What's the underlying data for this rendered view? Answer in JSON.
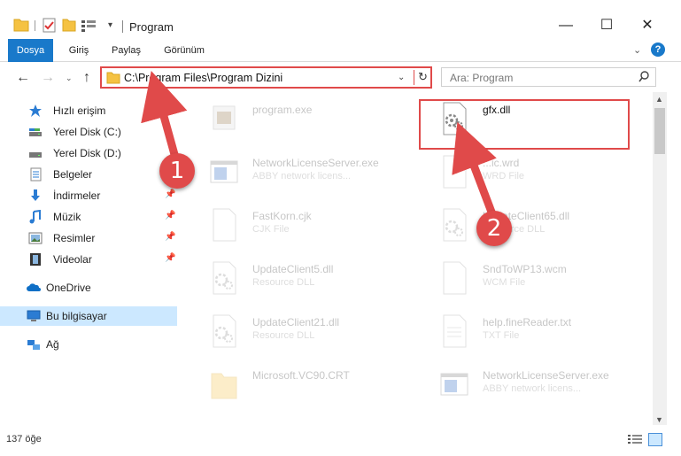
{
  "window": {
    "title": "Program",
    "minimize": "—",
    "maximize": "☐",
    "close": "✕"
  },
  "ribbon": {
    "tabs": [
      "Dosya",
      "Giriş",
      "Paylaş",
      "Görünüm"
    ],
    "help": "?"
  },
  "nav": {
    "address": "C:\\Program Files\\Program Dizini",
    "search_placeholder": "Ara: Program"
  },
  "sidebar": {
    "items": [
      {
        "label": "Hızlı erişim",
        "icon": "star-icon"
      },
      {
        "label": "Yerel Disk (C:)",
        "icon": "drive-icon"
      },
      {
        "label": "Yerel Disk (D:)",
        "icon": "drive-icon"
      },
      {
        "label": "Belgeler",
        "icon": "documents-icon"
      },
      {
        "label": "İndirmeler",
        "icon": "download-icon"
      },
      {
        "label": "Müzik",
        "icon": "music-icon"
      },
      {
        "label": "Resimler",
        "icon": "pictures-icon"
      },
      {
        "label": "Videolar",
        "icon": "video-icon"
      },
      {
        "label": "OneDrive",
        "icon": "cloud-icon"
      },
      {
        "label": "Bu bilgisayar",
        "icon": "computer-icon"
      },
      {
        "label": "Ağ",
        "icon": "network-icon"
      }
    ]
  },
  "files": [
    {
      "name": "program.exe",
      "type": "",
      "icon": "exe-icon"
    },
    {
      "name": "gfx.dll",
      "type": "",
      "icon": "dll-gear-icon"
    },
    {
      "name": "NetworkLicenseServer.exe",
      "type": "ABBY network licens...",
      "icon": "app-window-icon"
    },
    {
      "name": "...ic.wrd",
      "type": "WRD File",
      "icon": "blank-file-icon"
    },
    {
      "name": "FastKorn.cjk",
      "type": "CJK File",
      "icon": "blank-file-icon"
    },
    {
      "name": "UpdateClient65.dll",
      "type": "Resource DLL",
      "icon": "dll-gear-icon"
    },
    {
      "name": "UpdateClient5.dll",
      "type": "Resource DLL",
      "icon": "dll-gear-icon"
    },
    {
      "name": "SndToWP13.wcm",
      "type": "WCM File",
      "icon": "blank-file-icon"
    },
    {
      "name": "UpdateClient21.dll",
      "type": "Resource DLL",
      "icon": "dll-gear-icon"
    },
    {
      "name": "help.fineReader.txt",
      "type": "TXT File",
      "icon": "text-file-icon"
    },
    {
      "name": "Microsoft.VC90.CRT",
      "type": "",
      "icon": "folder-icon"
    },
    {
      "name": "NetworkLicenseServer.exe",
      "type": "ABBY network licens...",
      "icon": "app-window-icon"
    }
  ],
  "callouts": [
    "1",
    "2"
  ],
  "status": {
    "count": "137 öğe"
  },
  "colors": {
    "accent": "#1979ca",
    "highlight": "#e04a4a",
    "selected": "#cce8ff"
  }
}
